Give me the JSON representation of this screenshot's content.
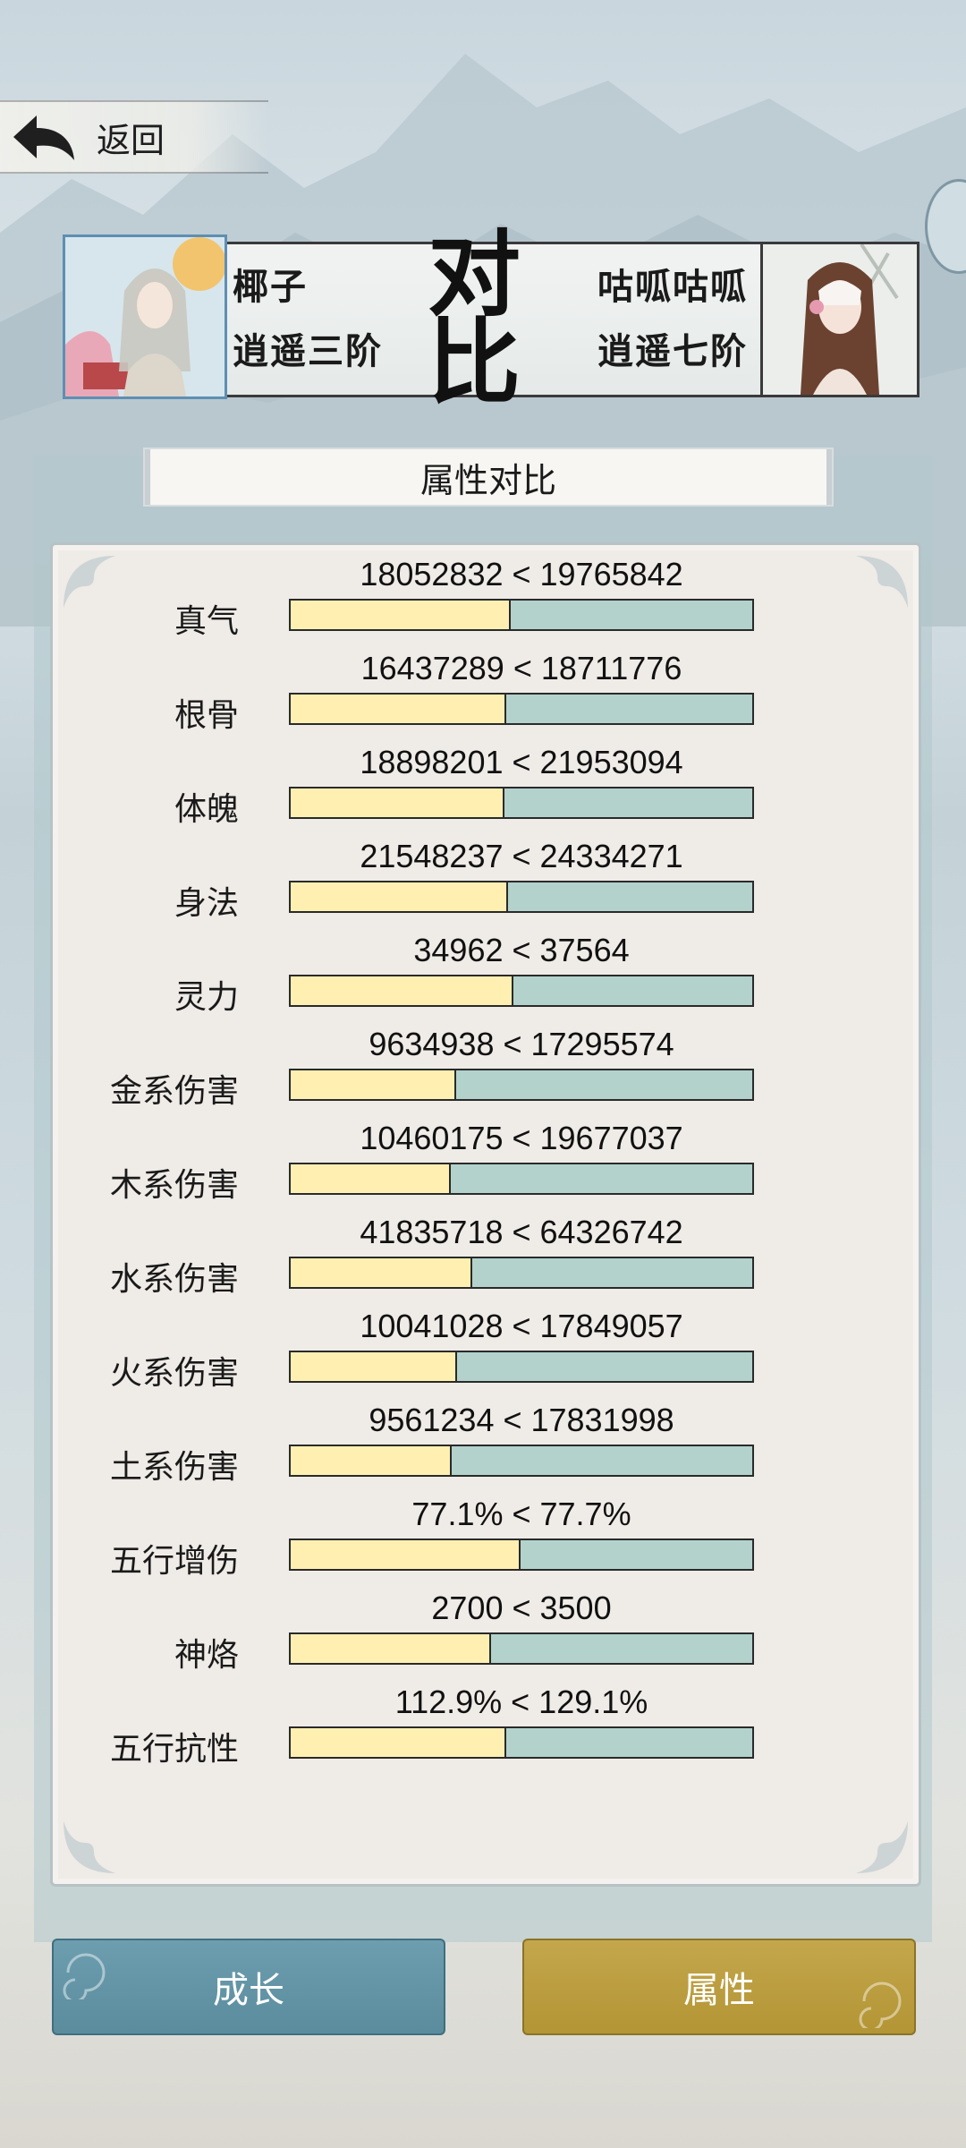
{
  "nav": {
    "back_label": "返回"
  },
  "compare": {
    "vs_top": "对",
    "vs_bottom": "比",
    "left_player": {
      "name": "椰子",
      "rank": "逍遥三阶"
    },
    "right_player": {
      "name": "咕呱咕呱",
      "rank": "逍遥七阶"
    }
  },
  "section_title": "属性对比",
  "stats": [
    {
      "label": "真气",
      "values": "18052832 < 19765842",
      "left_share": 0.477
    },
    {
      "label": "根骨",
      "values": "16437289 < 18711776",
      "left_share": 0.468
    },
    {
      "label": "体魄",
      "values": "18898201 < 21953094",
      "left_share": 0.463
    },
    {
      "label": "身法",
      "values": "21548237 < 24334271",
      "left_share": 0.47
    },
    {
      "label": "灵力",
      "values": "34962 < 37564",
      "left_share": 0.482
    },
    {
      "label": "金系伤害",
      "values": "9634938 < 17295574",
      "left_share": 0.358
    },
    {
      "label": "木系伤害",
      "values": "10460175 < 19677037",
      "left_share": 0.347
    },
    {
      "label": "水系伤害",
      "values": "41835718 < 64326742",
      "left_share": 0.394
    },
    {
      "label": "火系伤害",
      "values": "10041028 < 17849057",
      "left_share": 0.36
    },
    {
      "label": "土系伤害",
      "values": "9561234 < 17831998",
      "left_share": 0.349
    },
    {
      "label": "五行增伤",
      "values": "77.1% < 77.7%",
      "left_share": 0.498
    },
    {
      "label": "神烙",
      "values": "2700 < 3500",
      "left_share": 0.435
    },
    {
      "label": "五行抗性",
      "values": "112.9% < 129.1%",
      "left_share": 0.467
    }
  ],
  "buttons": {
    "grow_label": "成长",
    "attr_label": "属性"
  },
  "colors": {
    "left_bar": "#fff0b2",
    "right_bar": "#b3d2cc",
    "grow_button": "#6296a7",
    "attr_button": "#bca042"
  }
}
